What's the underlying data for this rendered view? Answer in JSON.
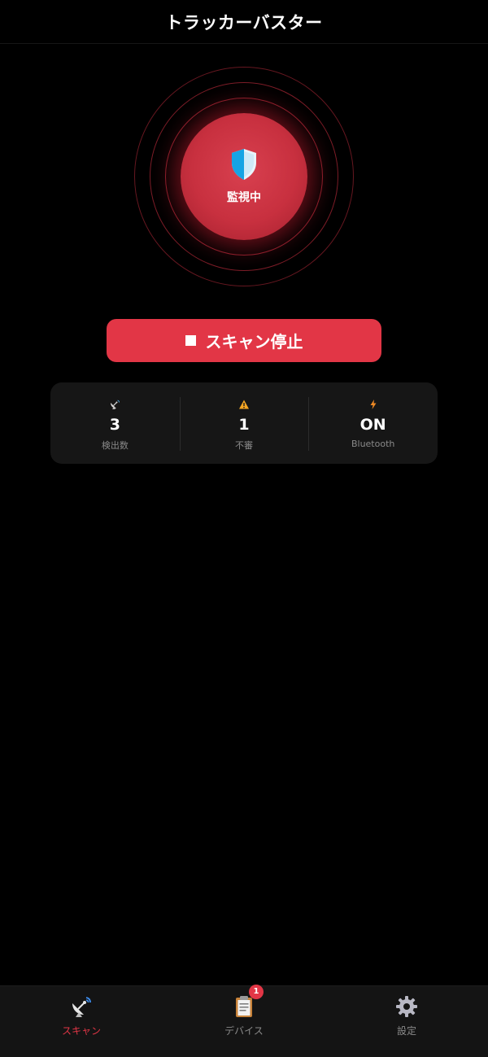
{
  "header": {
    "title": "トラッカーバスター"
  },
  "radar": {
    "status_label": "監視中",
    "icon": "shield-icon"
  },
  "scan_button": {
    "label": "スキャン停止",
    "icon": "stop-square-icon"
  },
  "stats": [
    {
      "icon": "satellite-dish-icon",
      "value": "3",
      "label": "検出数"
    },
    {
      "icon": "warning-icon",
      "value": "1",
      "label": "不審"
    },
    {
      "icon": "lightning-icon",
      "value": "ON",
      "label": "Bluetooth"
    }
  ],
  "bottom_nav": {
    "items": [
      {
        "icon": "satellite-dish-icon",
        "label": "スキャン",
        "active": true
      },
      {
        "icon": "clipboard-icon",
        "label": "デバイス",
        "badge": "1"
      },
      {
        "icon": "gear-icon",
        "label": "設定"
      }
    ]
  },
  "colors": {
    "accent": "#e23646",
    "background": "#000000",
    "card": "#161616",
    "muted_text": "#8a8a8a"
  }
}
